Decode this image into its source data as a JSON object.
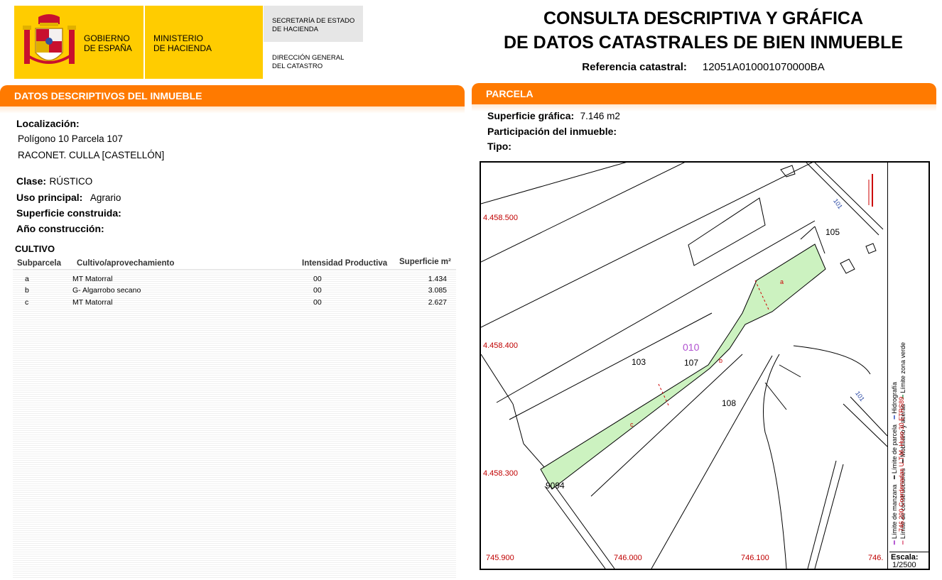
{
  "header": {
    "gov_line1": "GOBIERNO",
    "gov_line2": "DE ESPAÑA",
    "min_line1": "MINISTERIO",
    "min_line2": "DE HACIENDA",
    "sec_line1": "SECRETARÍA DE ESTADO",
    "sec_line2": "DE HACIENDA",
    "dg_line1": "DIRECCIÓN GENERAL",
    "dg_line2": "DEL CATASTRO",
    "title_line1": "CONSULTA DESCRIPTIVA Y GRÁFICA",
    "title_line2": "DE DATOS CATASTRALES DE BIEN INMUEBLE",
    "ref_label": "Referencia catastral:",
    "ref_value": "12051A010001070000BA"
  },
  "left": {
    "tab": "DATOS DESCRIPTIVOS DEL INMUEBLE",
    "loc_label": "Localización:",
    "loc_line1": "Polígono 10 Parcela 107",
    "loc_line2": "RACONET. CULLA [CASTELLÓN]",
    "clase_label": "Clase:",
    "clase_value": "RÚSTICO",
    "uso_label": "Uso principal:",
    "uso_value": "Agrario",
    "sup_label": "Superficie construida:",
    "ano_label": "Año construcción:",
    "cultivo_title": "CULTIVO",
    "columns": [
      "Subparcela",
      "Cultivo/aprovechamiento",
      "Intensidad Productiva",
      "Superficie m²"
    ],
    "rows": [
      {
        "sub": "a",
        "cultivo": "MT Matorral",
        "intensidad": "00",
        "superficie": "1.434"
      },
      {
        "sub": "b",
        "cultivo": "G- Algarrobo secano",
        "intensidad": "00",
        "superficie": "3.085"
      },
      {
        "sub": "c",
        "cultivo": "MT Matorral",
        "intensidad": "00",
        "superficie": "2.627"
      }
    ]
  },
  "right": {
    "tab": "PARCELA",
    "supg_label": "Superficie gráfica:",
    "supg_value": "7.146 m2",
    "part_label": "Participación del inmueble:",
    "tipo_label": "Tipo:"
  },
  "map": {
    "y_labels": [
      "4.458.500",
      "4.458.400",
      "4.458.300"
    ],
    "x_labels": [
      "745.900",
      "746.000",
      "746.100",
      "746."
    ],
    "parcel_labels": [
      "105",
      "103",
      "107",
      "108",
      "9094",
      "010"
    ],
    "subparcel_labels": [
      "a",
      "b",
      "c"
    ],
    "road_labels": [
      "101",
      "101"
    ],
    "legend": [
      "Límite de manzana",
      "Límite de parcela",
      "Hidrografía",
      "Límite de construcciones",
      "Mobiliario y aceras",
      "Límite zona verde"
    ],
    "coords_text": "746.200 Coordenadas U.T.M. Huso 30 ETRS89",
    "scale_label": "Escala:",
    "scale_value": "1/2500",
    "colors": {
      "parcel_fill": "#ccf2c0",
      "coord_red": "#c00000",
      "accent": "#ff7a00"
    }
  }
}
